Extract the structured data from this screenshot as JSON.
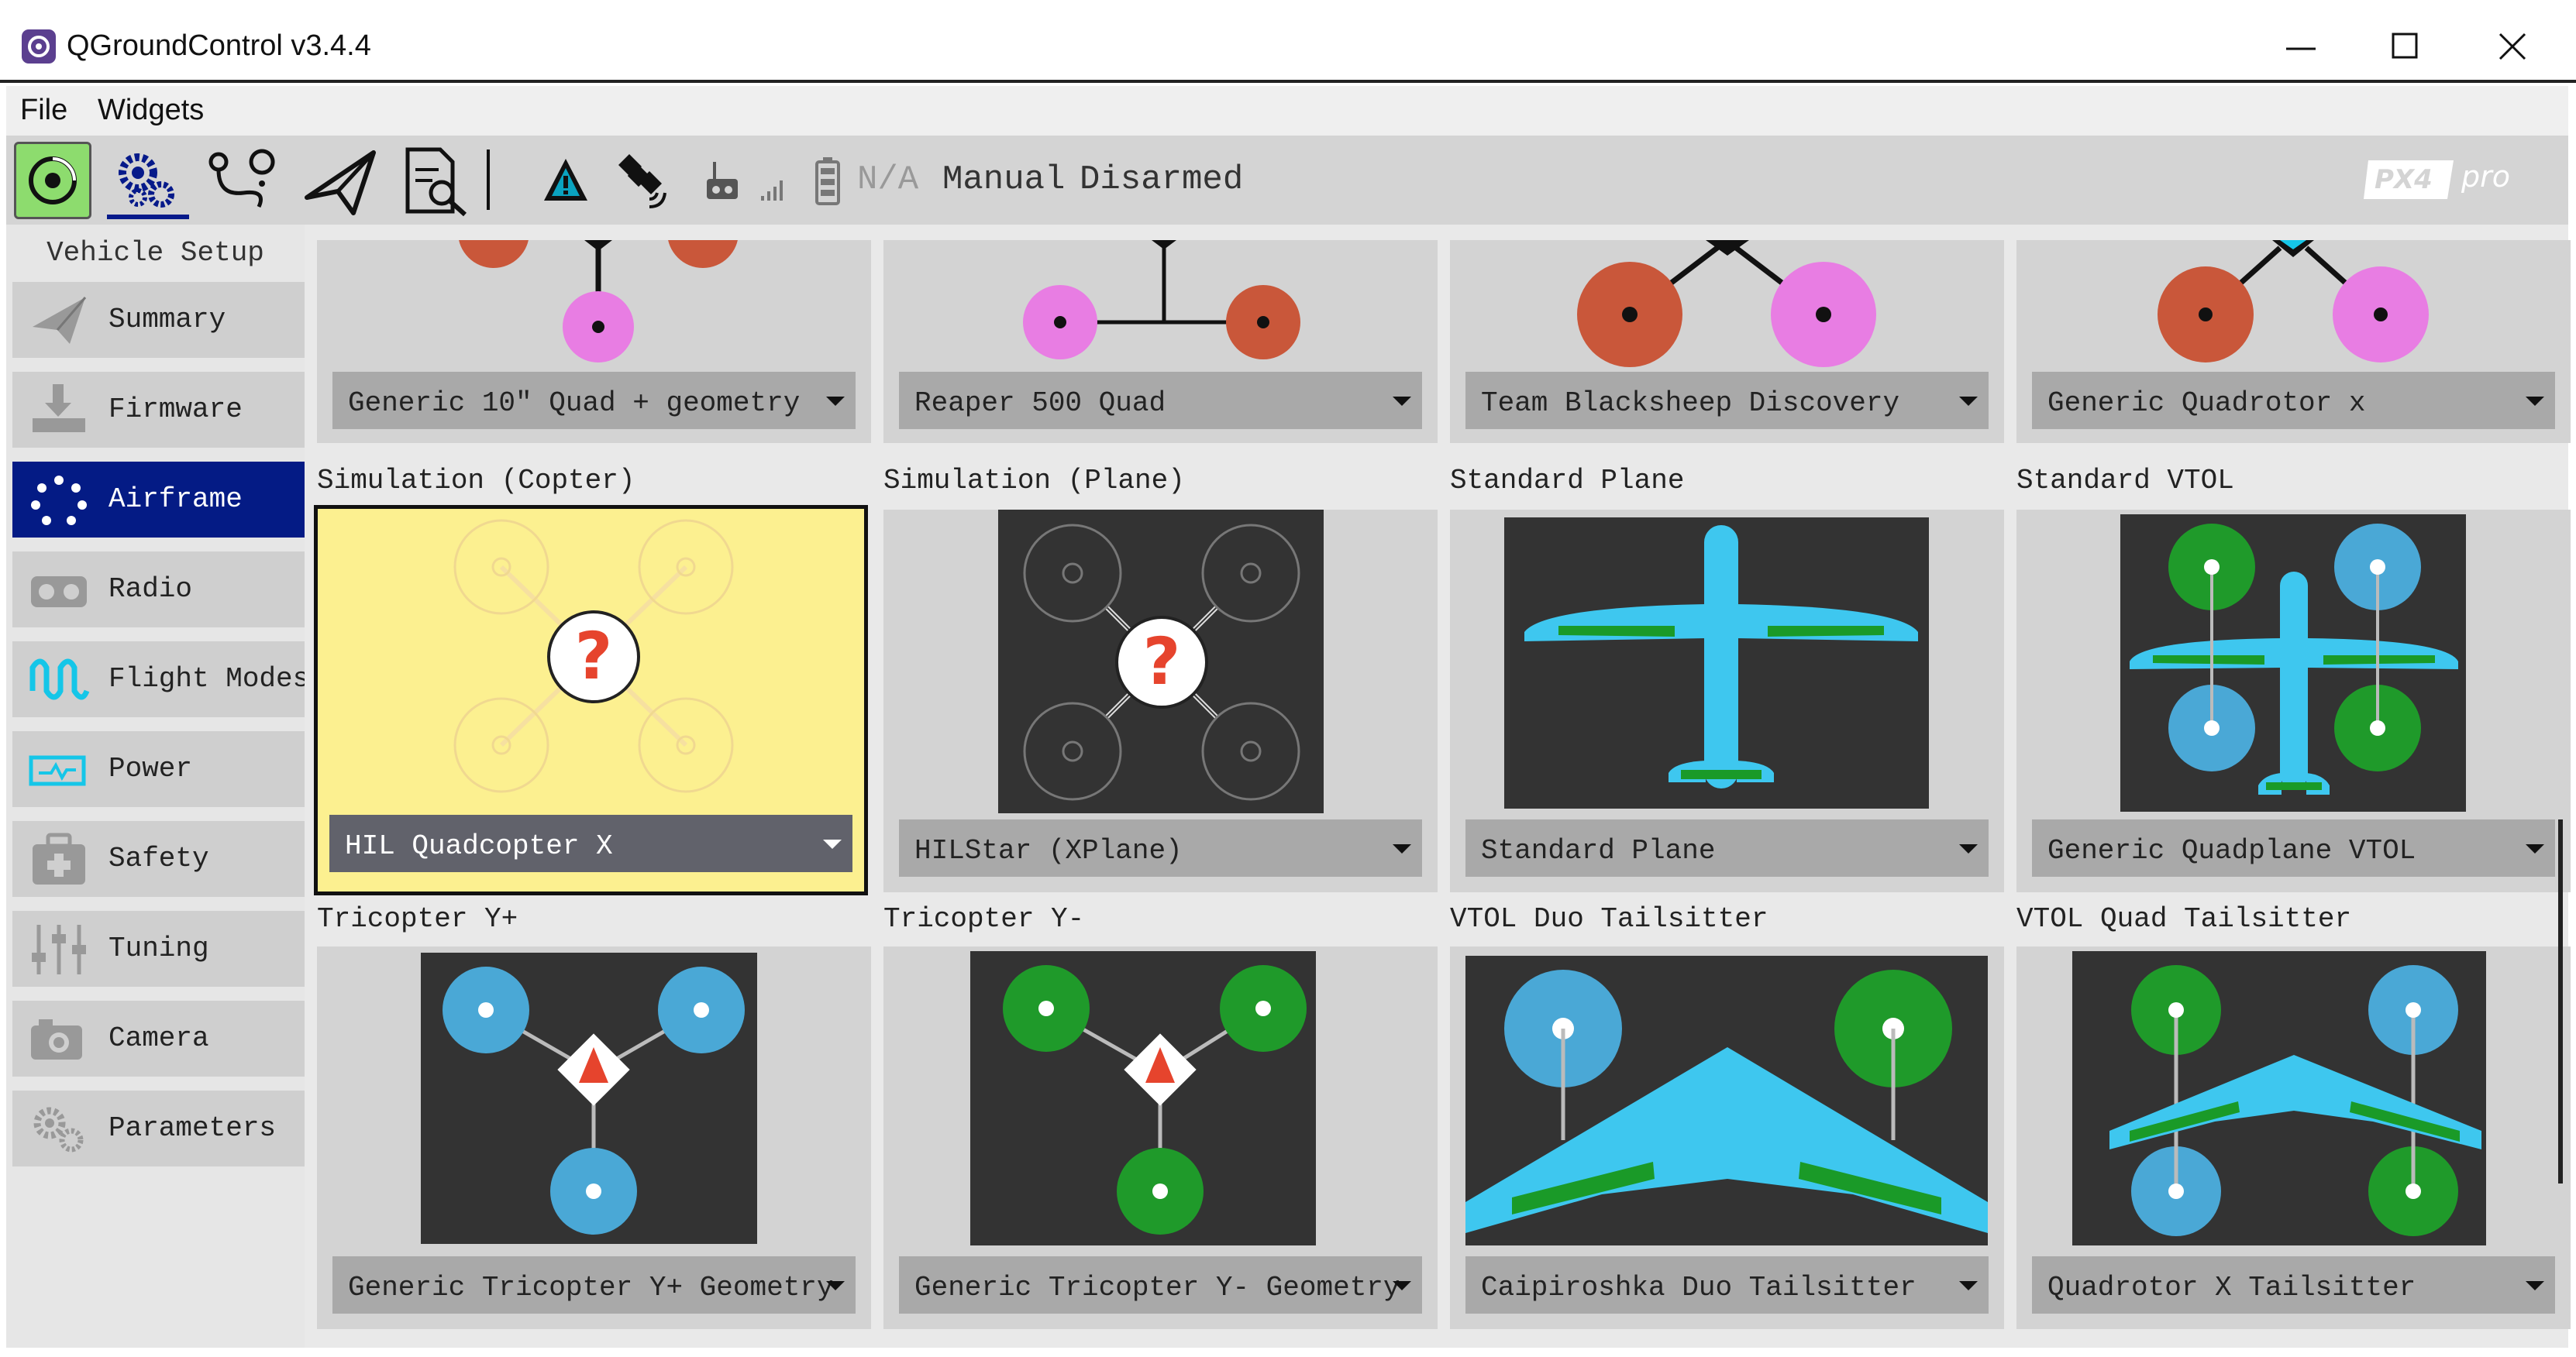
{
  "window": {
    "title": "QGroundControl v3.4.4"
  },
  "menu": {
    "file": "File",
    "widgets": "Widgets"
  },
  "toolbar": {
    "icons": [
      "qgc-logo-icon",
      "gears-icon",
      "plan-route-icon",
      "paper-plane-icon",
      "analyze-icon",
      "warning-icon",
      "gps-satellite-icon",
      "rc-transmitter-icon",
      "signal-bars-icon",
      "battery-icon"
    ],
    "battery": "N/A",
    "flight_mode": "Manual",
    "arm_state": "Disarmed",
    "brand": "PX4 PRO"
  },
  "sidebar": {
    "title": "Vehicle Setup",
    "items": [
      {
        "label": "Summary",
        "icon": "paper-plane-icon"
      },
      {
        "label": "Firmware",
        "icon": "download-icon"
      },
      {
        "label": "Airframe",
        "icon": "airframe-dots-icon",
        "active": true
      },
      {
        "label": "Radio",
        "icon": "radio-icon"
      },
      {
        "label": "Flight Modes",
        "icon": "wave-icon"
      },
      {
        "label": "Power",
        "icon": "power-icon"
      },
      {
        "label": "Safety",
        "icon": "first-aid-icon"
      },
      {
        "label": "Tuning",
        "icon": "sliders-icon"
      },
      {
        "label": "Camera",
        "icon": "camera-icon"
      },
      {
        "label": "Parameters",
        "icon": "gears-icon"
      }
    ]
  },
  "airframes": {
    "top": [
      {
        "selected": "Generic 10\" Quad + geometry"
      },
      {
        "selected": "Reaper 500 Quad"
      },
      {
        "selected": "Team Blacksheep Discovery"
      },
      {
        "selected": "Generic Quadrotor x"
      }
    ],
    "middle": [
      {
        "title": "Simulation (Copter)",
        "selected": "HIL Quadcopter X",
        "highlighted": true
      },
      {
        "title": "Simulation (Plane)",
        "selected": "HILStar (XPlane)"
      },
      {
        "title": "Standard Plane",
        "selected": "Standard Plane"
      },
      {
        "title": "Standard VTOL",
        "selected": "Generic Quadplane VTOL"
      }
    ],
    "bottom": [
      {
        "title": "Tricopter Y+",
        "selected": "Generic Tricopter Y+ Geometry"
      },
      {
        "title": "Tricopter Y-",
        "selected": "Generic Tricopter Y- Geometry"
      },
      {
        "title": "VTOL Duo Tailsitter",
        "selected": "Caipiroshka Duo Tailsitter"
      },
      {
        "title": "VTOL Quad Tailsitter",
        "selected": "Quadrotor X Tailsitter"
      }
    ]
  },
  "colors": {
    "accent": "#041b85",
    "selected_card": "#fcf090",
    "motor_cw": "#e87de3",
    "motor_ccw": "#c9573a",
    "prop_blue": "#4aa8d6",
    "prop_green": "#1f9a2a",
    "wing": "#3ec7ef",
    "wing_green": "#1a9a28"
  }
}
